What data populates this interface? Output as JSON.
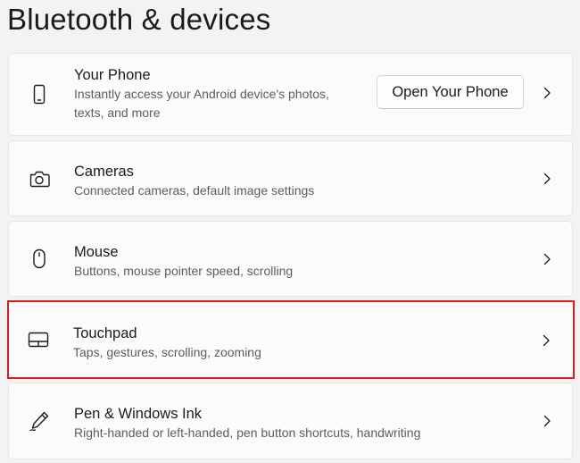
{
  "page": {
    "title": "Bluetooth & devices"
  },
  "items": [
    {
      "title": "Your Phone",
      "subtitle_line1": "Instantly access your Android device's photos,",
      "subtitle_line2": "texts, and more",
      "button_label": "Open Your Phone",
      "icon": "phone-icon"
    },
    {
      "title": "Cameras",
      "subtitle": "Connected cameras, default image settings",
      "icon": "camera-icon"
    },
    {
      "title": "Mouse",
      "subtitle": "Buttons, mouse pointer speed, scrolling",
      "icon": "mouse-icon"
    },
    {
      "title": "Touchpad",
      "subtitle": "Taps, gestures, scrolling, zooming",
      "icon": "touchpad-icon",
      "highlighted": true
    },
    {
      "title": "Pen & Windows Ink",
      "subtitle": "Right-handed or left-handed, pen button shortcuts, handwriting",
      "icon": "pen-icon"
    }
  ],
  "colors": {
    "background": "#f3f3f3",
    "card": "#fbfbfb",
    "highlight_border": "#e0191d",
    "secondary_text": "#5d5d5d"
  }
}
